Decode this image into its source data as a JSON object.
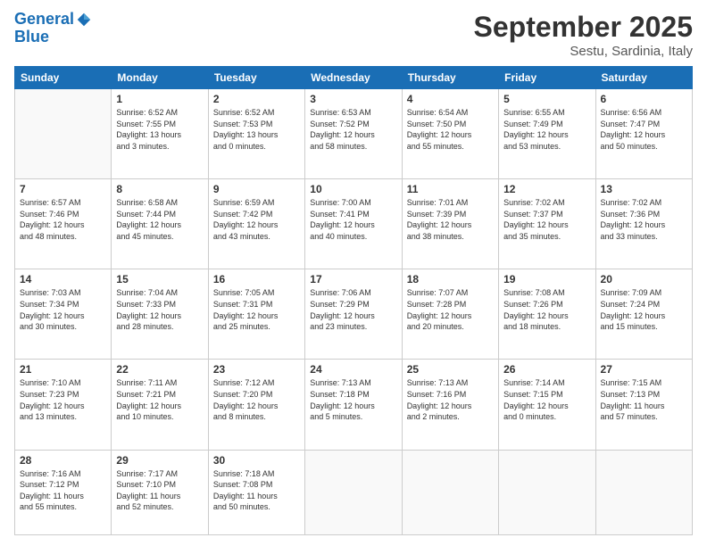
{
  "logo": {
    "line1": "General",
    "line2": "Blue"
  },
  "header": {
    "month": "September 2025",
    "location": "Sestu, Sardinia, Italy"
  },
  "weekdays": [
    "Sunday",
    "Monday",
    "Tuesday",
    "Wednesday",
    "Thursday",
    "Friday",
    "Saturday"
  ],
  "weeks": [
    [
      {
        "day": "",
        "info": ""
      },
      {
        "day": "1",
        "info": "Sunrise: 6:52 AM\nSunset: 7:55 PM\nDaylight: 13 hours\nand 3 minutes."
      },
      {
        "day": "2",
        "info": "Sunrise: 6:52 AM\nSunset: 7:53 PM\nDaylight: 13 hours\nand 0 minutes."
      },
      {
        "day": "3",
        "info": "Sunrise: 6:53 AM\nSunset: 7:52 PM\nDaylight: 12 hours\nand 58 minutes."
      },
      {
        "day": "4",
        "info": "Sunrise: 6:54 AM\nSunset: 7:50 PM\nDaylight: 12 hours\nand 55 minutes."
      },
      {
        "day": "5",
        "info": "Sunrise: 6:55 AM\nSunset: 7:49 PM\nDaylight: 12 hours\nand 53 minutes."
      },
      {
        "day": "6",
        "info": "Sunrise: 6:56 AM\nSunset: 7:47 PM\nDaylight: 12 hours\nand 50 minutes."
      }
    ],
    [
      {
        "day": "7",
        "info": "Sunrise: 6:57 AM\nSunset: 7:46 PM\nDaylight: 12 hours\nand 48 minutes."
      },
      {
        "day": "8",
        "info": "Sunrise: 6:58 AM\nSunset: 7:44 PM\nDaylight: 12 hours\nand 45 minutes."
      },
      {
        "day": "9",
        "info": "Sunrise: 6:59 AM\nSunset: 7:42 PM\nDaylight: 12 hours\nand 43 minutes."
      },
      {
        "day": "10",
        "info": "Sunrise: 7:00 AM\nSunset: 7:41 PM\nDaylight: 12 hours\nand 40 minutes."
      },
      {
        "day": "11",
        "info": "Sunrise: 7:01 AM\nSunset: 7:39 PM\nDaylight: 12 hours\nand 38 minutes."
      },
      {
        "day": "12",
        "info": "Sunrise: 7:02 AM\nSunset: 7:37 PM\nDaylight: 12 hours\nand 35 minutes."
      },
      {
        "day": "13",
        "info": "Sunrise: 7:02 AM\nSunset: 7:36 PM\nDaylight: 12 hours\nand 33 minutes."
      }
    ],
    [
      {
        "day": "14",
        "info": "Sunrise: 7:03 AM\nSunset: 7:34 PM\nDaylight: 12 hours\nand 30 minutes."
      },
      {
        "day": "15",
        "info": "Sunrise: 7:04 AM\nSunset: 7:33 PM\nDaylight: 12 hours\nand 28 minutes."
      },
      {
        "day": "16",
        "info": "Sunrise: 7:05 AM\nSunset: 7:31 PM\nDaylight: 12 hours\nand 25 minutes."
      },
      {
        "day": "17",
        "info": "Sunrise: 7:06 AM\nSunset: 7:29 PM\nDaylight: 12 hours\nand 23 minutes."
      },
      {
        "day": "18",
        "info": "Sunrise: 7:07 AM\nSunset: 7:28 PM\nDaylight: 12 hours\nand 20 minutes."
      },
      {
        "day": "19",
        "info": "Sunrise: 7:08 AM\nSunset: 7:26 PM\nDaylight: 12 hours\nand 18 minutes."
      },
      {
        "day": "20",
        "info": "Sunrise: 7:09 AM\nSunset: 7:24 PM\nDaylight: 12 hours\nand 15 minutes."
      }
    ],
    [
      {
        "day": "21",
        "info": "Sunrise: 7:10 AM\nSunset: 7:23 PM\nDaylight: 12 hours\nand 13 minutes."
      },
      {
        "day": "22",
        "info": "Sunrise: 7:11 AM\nSunset: 7:21 PM\nDaylight: 12 hours\nand 10 minutes."
      },
      {
        "day": "23",
        "info": "Sunrise: 7:12 AM\nSunset: 7:20 PM\nDaylight: 12 hours\nand 8 minutes."
      },
      {
        "day": "24",
        "info": "Sunrise: 7:13 AM\nSunset: 7:18 PM\nDaylight: 12 hours\nand 5 minutes."
      },
      {
        "day": "25",
        "info": "Sunrise: 7:13 AM\nSunset: 7:16 PM\nDaylight: 12 hours\nand 2 minutes."
      },
      {
        "day": "26",
        "info": "Sunrise: 7:14 AM\nSunset: 7:15 PM\nDaylight: 12 hours\nand 0 minutes."
      },
      {
        "day": "27",
        "info": "Sunrise: 7:15 AM\nSunset: 7:13 PM\nDaylight: 11 hours\nand 57 minutes."
      }
    ],
    [
      {
        "day": "28",
        "info": "Sunrise: 7:16 AM\nSunset: 7:12 PM\nDaylight: 11 hours\nand 55 minutes."
      },
      {
        "day": "29",
        "info": "Sunrise: 7:17 AM\nSunset: 7:10 PM\nDaylight: 11 hours\nand 52 minutes."
      },
      {
        "day": "30",
        "info": "Sunrise: 7:18 AM\nSunset: 7:08 PM\nDaylight: 11 hours\nand 50 minutes."
      },
      {
        "day": "",
        "info": ""
      },
      {
        "day": "",
        "info": ""
      },
      {
        "day": "",
        "info": ""
      },
      {
        "day": "",
        "info": ""
      }
    ]
  ]
}
